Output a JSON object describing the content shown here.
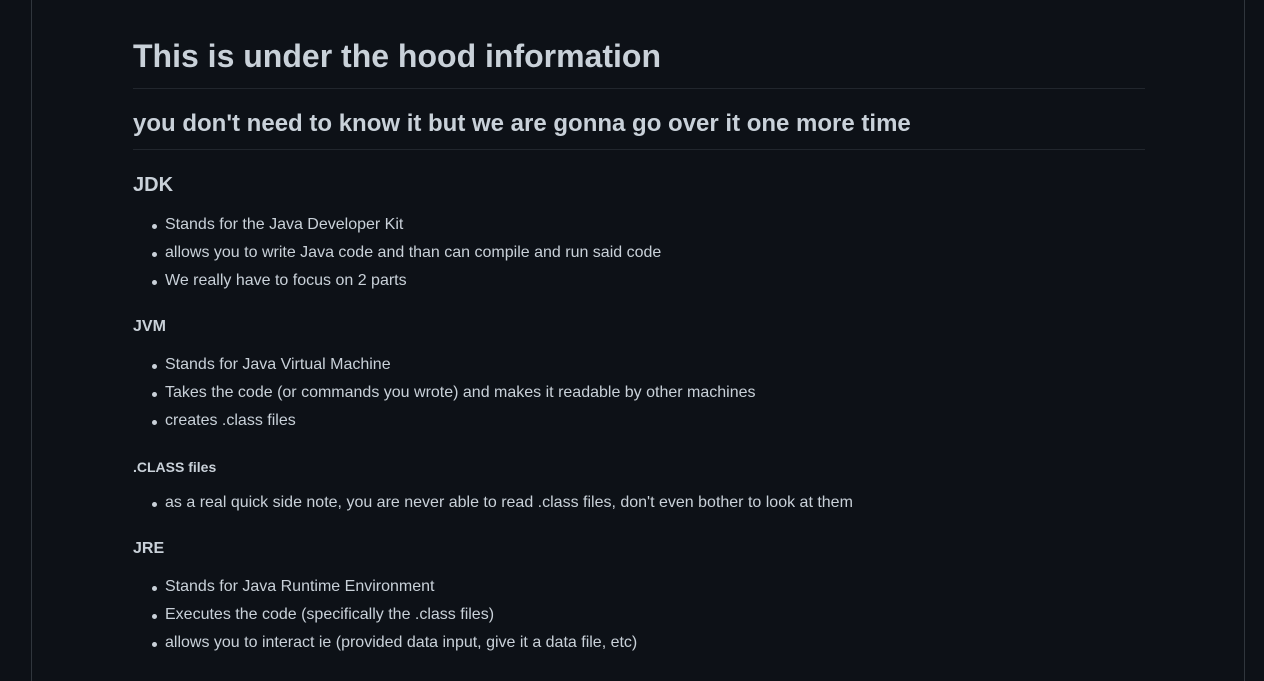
{
  "title": "This is under the hood information",
  "subtitle": "you don't need to know it but we are gonna go over it one more time",
  "sections": {
    "jdk": {
      "heading": "JDK",
      "items": [
        "Stands for the Java Developer Kit",
        "allows you to write Java code and than can compile and run said code",
        "We really have to focus on 2 parts"
      ]
    },
    "jvm": {
      "heading": "JVM",
      "items": [
        "Stands for Java Virtual Machine",
        "Takes the code (or commands you wrote) and makes it readable by other machines",
        "creates .class files"
      ]
    },
    "class_files": {
      "heading": ".CLASS files",
      "items": [
        "as a real quick side note, you are never able to read .class files, don't even bother to look at them"
      ]
    },
    "jre": {
      "heading": "JRE",
      "items": [
        "Stands for Java Runtime Environment",
        "Executes the code (specifically the .class files)",
        "allows you to interact ie (provided data input, give it a data file, etc)"
      ]
    }
  }
}
